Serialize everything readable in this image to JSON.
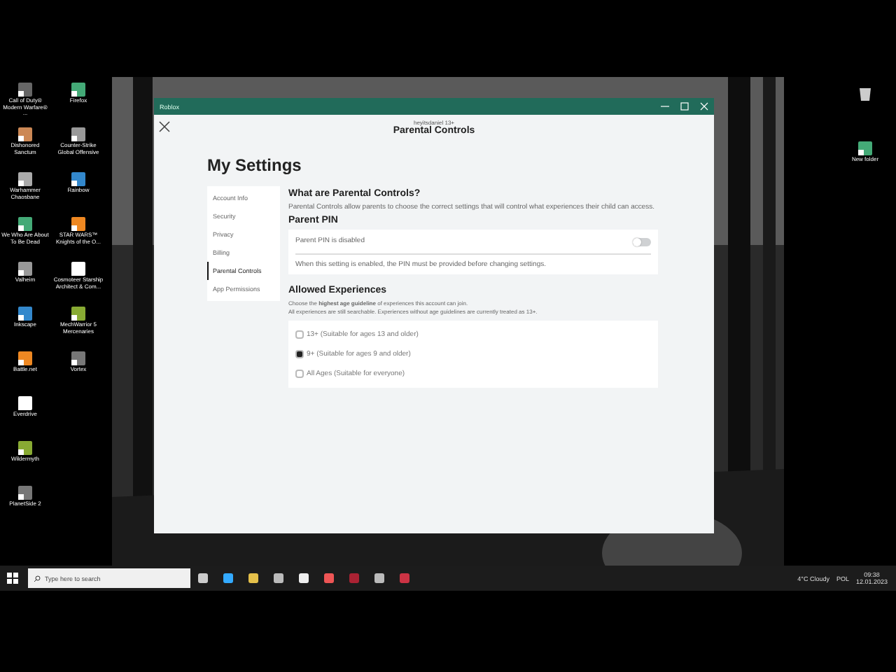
{
  "desktop": {
    "left_columns": [
      [
        "Call of Duty® Modern Warfare® ...",
        "Dishonored Sanctum",
        "Warhammer Chaosbane",
        "We Who Are About To Be Dead",
        "Valheim",
        "Inkscape",
        "Battle.net",
        "Everdrive",
        "Wildermyth",
        "PlanetSide 2"
      ],
      [
        "Firefox",
        "Counter-Strike Global Offensive",
        "Rainbow",
        "STAR WARS™ Knights of the O...",
        "Cosmoteer Starship Architect & Com...",
        "MechWarrior 5 Mercenaries",
        "Vortex"
      ]
    ],
    "right_icons": [
      {
        "kind": "bin"
      },
      {
        "kind": "folder",
        "label": "New folder"
      }
    ]
  },
  "window": {
    "title": "Roblox",
    "username": "heyitsdaniel 13+",
    "page_title": "Parental Controls",
    "heading": "My Settings",
    "sidebar": [
      {
        "label": "Account Info",
        "selected": false
      },
      {
        "label": "Security",
        "selected": false
      },
      {
        "label": "Privacy",
        "selected": false
      },
      {
        "label": "Billing",
        "selected": false
      },
      {
        "label": "Parental Controls",
        "selected": true
      },
      {
        "label": "App Permissions",
        "selected": false
      }
    ],
    "intro": {
      "title": "What are Parental Controls?",
      "text": "Parental Controls allow parents to choose the correct settings that will control what experiences their child can access."
    },
    "pin": {
      "title": "Parent PIN",
      "label": "Parent PIN is disabled",
      "on": false,
      "note": "When this setting is enabled, the PIN must be provided before changing settings."
    },
    "experiences": {
      "title": "Allowed Experiences",
      "lines": [
        "Choose the **highest age guideline** of experiences this account can join.",
        "All experiences are still searchable. Experiences without age guidelines are currently treated as 13+."
      ],
      "options": [
        {
          "label": "13+ (Suitable for ages 13 and older)",
          "selected": false
        },
        {
          "label": "9+ (Suitable for ages 9 and older)",
          "selected": true
        },
        {
          "label": "All Ages (Suitable for everyone)",
          "selected": false
        }
      ]
    }
  },
  "taskbar": {
    "search_placeholder": "Type here to search",
    "weather": "4°C  Cloudy",
    "language": "POL",
    "time": "09:38",
    "date": "12.01.2023"
  }
}
